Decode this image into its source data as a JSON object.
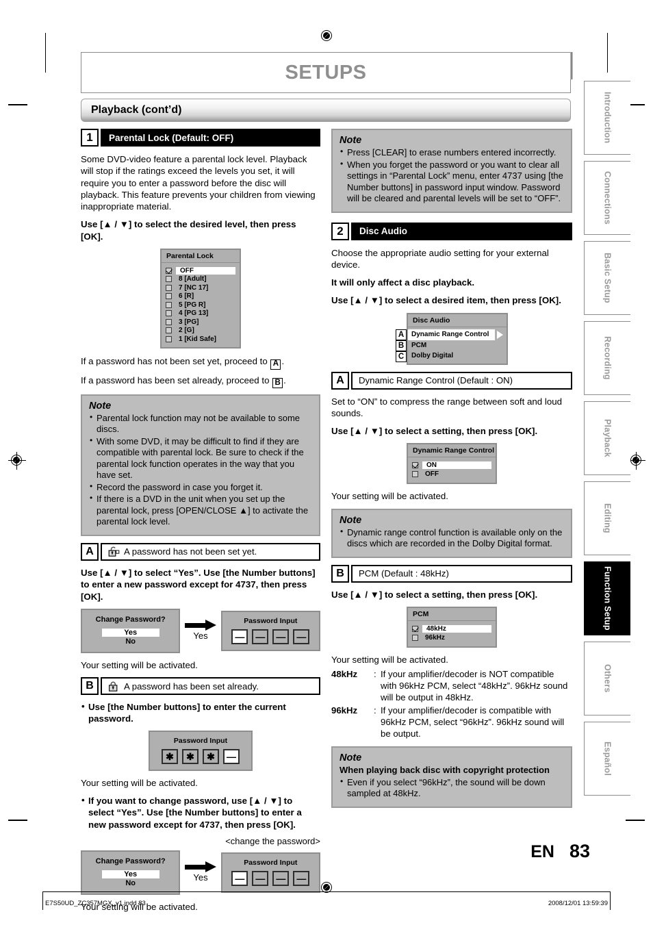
{
  "page": {
    "title": "SETUPS",
    "section": "Playback (cont’d)",
    "language_code": "EN",
    "page_number": "83"
  },
  "sidebar": {
    "tabs": [
      {
        "label": "Introduction",
        "active": false
      },
      {
        "label": "Connections",
        "active": false
      },
      {
        "label": "Basic Setup",
        "active": false
      },
      {
        "label": "Recording",
        "active": false
      },
      {
        "label": "Playback",
        "active": false
      },
      {
        "label": "Editing",
        "active": false
      },
      {
        "label": "Function Setup",
        "active": true
      },
      {
        "label": "Others",
        "active": false
      },
      {
        "label": "Español",
        "active": false
      }
    ]
  },
  "left_column": {
    "step1": {
      "number": "1",
      "heading": "Parental Lock (Default: OFF)",
      "intro": "Some DVD-video feature a parental lock level. Playback will stop if the ratings exceed the levels you set, it will require you to enter a password before the disc will playback. This feature prevents your children from viewing inappropriate material.",
      "instruction": "Use [▲ / ▼] to select the desired level, then press [OK].",
      "osd": {
        "title": "Parental Lock",
        "rows": [
          {
            "label": "OFF",
            "checked": true,
            "selected": true
          },
          {
            "label": "8 [Adult]",
            "checked": false,
            "selected": false
          },
          {
            "label": "7 [NC 17]",
            "checked": false,
            "selected": false
          },
          {
            "label": "6 [R]",
            "checked": false,
            "selected": false
          },
          {
            "label": "5 [PG R]",
            "checked": false,
            "selected": false
          },
          {
            "label": "4 [PG 13]",
            "checked": false,
            "selected": false
          },
          {
            "label": "3 [PG]",
            "checked": false,
            "selected": false
          },
          {
            "label": "2 [G]",
            "checked": false,
            "selected": false
          },
          {
            "label": "1 [Kid Safe]",
            "checked": false,
            "selected": false
          }
        ]
      },
      "proceed_a_pre": "If a password has not been set yet, proceed to ",
      "proceed_a_ref": "A",
      "proceed_a_post": ".",
      "proceed_b_pre": "If a password has been set already, proceed to ",
      "proceed_b_ref": "B",
      "proceed_b_post": ".",
      "note": {
        "title": "Note",
        "items": [
          "Parental lock function may not be available to some discs.",
          "With some DVD, it may be difficult to find if they are compatible with parental lock. Be sure to check if the parental lock function operates in the way that you have set.",
          "Record the password in case you forget it.",
          "If there is a DVD in the unit when you set up the parental lock, press [OPEN/CLOSE ▲] to activate the parental lock level."
        ]
      }
    },
    "section_a": {
      "letter": "A",
      "icon": "unlocked-padlock-icon",
      "heading": "A password has not been set yet.",
      "instruction": "Use [▲ / ▼] to select “Yes”. Use [the Number buttons] to enter a new password except for 4737, then press [OK].",
      "dialog": {
        "change_title": "Change Password?",
        "yes": "Yes",
        "no": "No",
        "arrow_label": "Yes",
        "pw_title": "Password Input",
        "pw_cells": [
          "—",
          "—",
          "—",
          "—"
        ]
      },
      "activated": "Your setting will be activated."
    },
    "section_b": {
      "letter": "B",
      "icon": "locked-padlock-icon",
      "heading": "A password has been set already.",
      "bullet1": "Use [the Number buttons] to enter the current password.",
      "dialog1": {
        "pw_title": "Password Input",
        "pw_cells": [
          "✱",
          "✱",
          "✱",
          "—"
        ]
      },
      "activated1": "Your setting will be activated.",
      "bullet2": "If you want to change password, use [▲ / ▼] to select “Yes”. Use [the Number buttons] to enter a new password except for 4737, then press [OK].",
      "change_caption": "<change the password>",
      "dialog2": {
        "change_title": "Change Password?",
        "yes": "Yes",
        "no": "No",
        "arrow_label": "Yes",
        "pw_title": "Password Input",
        "pw_cells": [
          "—",
          "—",
          "—",
          "—"
        ]
      },
      "activated2": "Your setting will be activated."
    }
  },
  "right_column": {
    "top_note": {
      "title": "Note",
      "items": [
        "Press [CLEAR] to erase numbers entered incorrectly.",
        "When you forget the password or you want to clear all settings in “Parental Lock” menu, enter 4737 using [the Number buttons] in password input window. Password will be cleared and parental levels will be set to “OFF”."
      ]
    },
    "step2": {
      "number": "2",
      "heading": "Disc Audio",
      "intro": "Choose the appropriate audio setting for your external device.",
      "bold_note": "It will only affect a disc playback.",
      "instruction": "Use [▲ / ▼] to select a desired item, then press [OK].",
      "osd": {
        "title": "Disc Audio",
        "rows": [
          {
            "letter": "A",
            "label": "Dynamic Range Control",
            "selected": true,
            "arrow": true
          },
          {
            "letter": "B",
            "label": "PCM",
            "selected": false,
            "arrow": false
          },
          {
            "letter": "C",
            "label": "Dolby Digital",
            "selected": false,
            "arrow": false
          }
        ]
      }
    },
    "section_a": {
      "letter": "A",
      "heading": "Dynamic Range Control (Default : ON)",
      "intro": "Set to “ON” to compress the range between soft and loud sounds.",
      "instruction": "Use [▲ / ▼] to select a setting, then press [OK].",
      "osd": {
        "title": "Dynamic Range Control",
        "rows": [
          {
            "label": "ON",
            "checked": true,
            "selected": true
          },
          {
            "label": "OFF",
            "checked": false,
            "selected": false
          }
        ]
      },
      "activated": "Your setting will be activated.",
      "note": {
        "title": "Note",
        "items": [
          "Dynamic range control function is available only on the discs which are recorded in the Dolby Digital format."
        ]
      }
    },
    "section_b": {
      "letter": "B",
      "heading": "PCM (Default : 48kHz)",
      "instruction": "Use [▲ / ▼] to select a setting, then press [OK].",
      "osd": {
        "title": "PCM",
        "rows": [
          {
            "label": "48kHz",
            "checked": true,
            "selected": true
          },
          {
            "label": "96kHz",
            "checked": false,
            "selected": false
          }
        ]
      },
      "activated": "Your setting will be activated.",
      "definitions": [
        {
          "term": "48kHz",
          "colon": ":",
          "desc": "If your amplifier/decoder is NOT compatible with 96kHz PCM, select “48kHz”. 96kHz sound will be output in 48kHz."
        },
        {
          "term": "96kHz",
          "colon": ":",
          "desc": "If your amplifier/decoder is compatible with 96kHz PCM, select “96kHz”. 96kHz sound will be output."
        }
      ],
      "note": {
        "title": "Note",
        "subtitle": "When playing back disc with copyright protection",
        "items": [
          "Even if you select “96kHz”, the sound will be down sampled at 48kHz."
        ]
      }
    }
  },
  "footer": {
    "left": "E7S50UD_ZC357MGX_v1.indd   83",
    "right": "2008/12/01   13:59:39"
  }
}
